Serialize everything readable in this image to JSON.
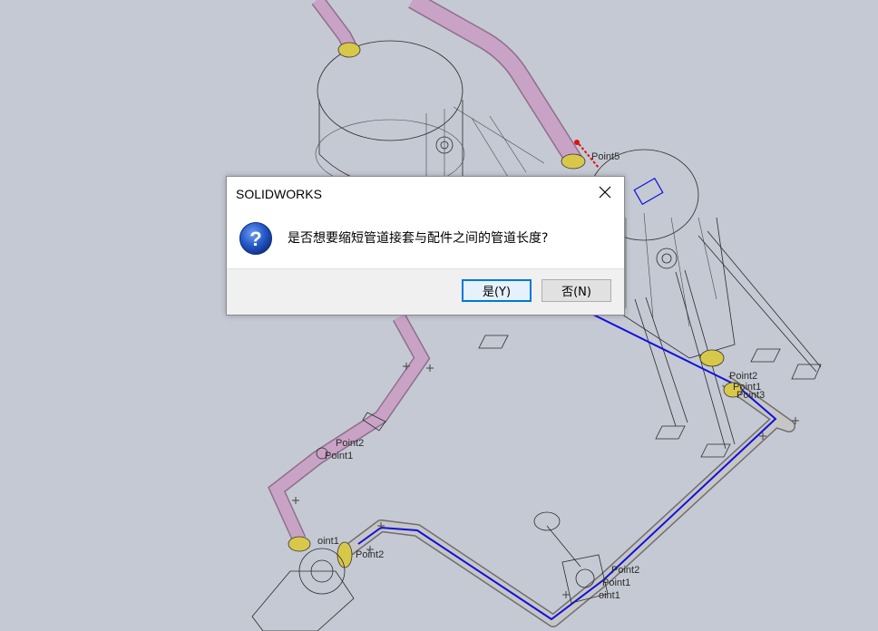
{
  "viewport": {
    "point_labels": [
      "Point5",
      "Point2",
      "Point1",
      "Point3",
      "Point2",
      "Point1",
      "oint1",
      "Point2",
      "Point2",
      "Point1",
      "oint1"
    ]
  },
  "dialog": {
    "title": "SOLIDWORKS",
    "icon": "question-icon",
    "message": "是否想要缩短管道接套与配件之间的管道长度?",
    "buttons": {
      "yes_label": "是(Y)",
      "no_label": "否(N)"
    }
  },
  "colors": {
    "background": "#c5c9d3",
    "route_line": "#1010e0",
    "pipe_pink": "#c9a3c6",
    "pipe_grey": "#b9b9b9",
    "flange_yellow": "#d8c84a",
    "accent": "#0078d7"
  }
}
